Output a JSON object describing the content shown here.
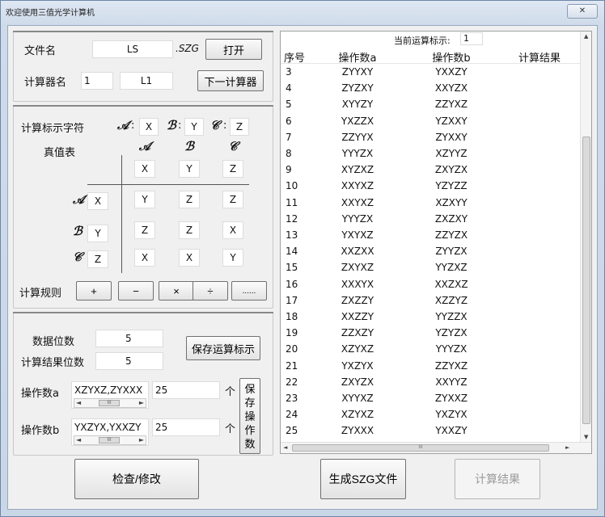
{
  "window": {
    "title": "欢迎使用三值光学计算机",
    "close_glyph": "✕"
  },
  "file": {
    "label": "文件名",
    "value": "LS",
    "ext": ".SZG",
    "open_button": "打开"
  },
  "calculator": {
    "label": "计算器名",
    "index": "1",
    "name": "L1",
    "next_button": "下一计算器"
  },
  "marks": {
    "label": "计算标示字符",
    "a_letter": "𝒜",
    "a_colon": ":",
    "a_value": "X",
    "b_letter": "ℬ",
    "b_colon": ":",
    "b_value": "Y",
    "c_letter": "𝒞",
    "c_colon": ":",
    "c_value": "Z"
  },
  "truth_table": {
    "label": "真值表",
    "col_letters": [
      "𝒜",
      "ℬ",
      "𝒞"
    ],
    "col_values": [
      "X",
      "Y",
      "Z"
    ],
    "row_letters": [
      "𝒜",
      "ℬ",
      "𝒞"
    ],
    "row_values": [
      "X",
      "Y",
      "Z"
    ],
    "cells": [
      [
        "Y",
        "Z",
        "Z"
      ],
      [
        "Z",
        "Z",
        "X"
      ],
      [
        "X",
        "X",
        "Y"
      ]
    ]
  },
  "rules": {
    "label": "计算规则",
    "buttons": [
      "+",
      "−",
      "×",
      "÷",
      "......"
    ]
  },
  "settings": {
    "data_bits_label": "数据位数",
    "data_bits": "5",
    "result_bits_label": "计算结果位数",
    "result_bits": "5",
    "save_marks_button": "保存运算标示",
    "operand_a_label": "操作数a",
    "operand_a_value": "XZYXZ,ZYXXX",
    "operand_a_count": "25",
    "operand_b_label": "操作数b",
    "operand_b_value": "YXZYX,YXXZY",
    "operand_b_count": "25",
    "unit": "个",
    "save_operands_button": "保存操作数",
    "scroll_thumb": "III"
  },
  "actions": {
    "check_button": "检查/修改",
    "generate_button": "生成SZG文件",
    "result_button": "计算结果"
  },
  "list": {
    "current_label": "当前运算标示:",
    "current_value": "1",
    "headers": [
      "序号",
      "操作数a",
      "操作数b",
      "计算结果"
    ],
    "rows": [
      [
        "3",
        "ZYYXY",
        "YXXZY",
        ""
      ],
      [
        "4",
        "ZYZXY",
        "XXYZX",
        ""
      ],
      [
        "5",
        "XYYZY",
        "ZZYXZ",
        ""
      ],
      [
        "6",
        "YXZZX",
        "YZXXY",
        ""
      ],
      [
        "7",
        "ZZYYX",
        "ZYXXY",
        ""
      ],
      [
        "8",
        "YYYZX",
        "XZYYZ",
        ""
      ],
      [
        "9",
        "XYZXZ",
        "ZXYZX",
        ""
      ],
      [
        "10",
        "XXYXZ",
        "YZYZZ",
        ""
      ],
      [
        "11",
        "XXYXZ",
        "XZXYY",
        ""
      ],
      [
        "12",
        "YYYZX",
        "ZXZXY",
        ""
      ],
      [
        "13",
        "YXYXZ",
        "ZZYZX",
        ""
      ],
      [
        "14",
        "XXZXX",
        "ZYYZX",
        ""
      ],
      [
        "15",
        "ZXYXZ",
        "YYZXZ",
        ""
      ],
      [
        "16",
        "XXXYX",
        "XXZXZ",
        ""
      ],
      [
        "17",
        "ZXZZY",
        "XZZYZ",
        ""
      ],
      [
        "18",
        "XXZZY",
        "YYZZX",
        ""
      ],
      [
        "19",
        "ZZXZY",
        "YZYZX",
        ""
      ],
      [
        "20",
        "XZYXZ",
        "YYYZX",
        ""
      ],
      [
        "21",
        "YXZYX",
        "ZZYXZ",
        ""
      ],
      [
        "22",
        "ZXYZX",
        "XXYYZ",
        ""
      ],
      [
        "23",
        "XYYXZ",
        "ZYXXZ",
        ""
      ],
      [
        "24",
        "XZYXZ",
        "YXZYX",
        ""
      ],
      [
        "25",
        "ZYXXX",
        "YXXZY",
        ""
      ]
    ],
    "hscroll_thumb": "III",
    "up_arrow": "▲",
    "down_arrow": "▼",
    "left_arrow": "◄",
    "right_arrow": "►"
  }
}
